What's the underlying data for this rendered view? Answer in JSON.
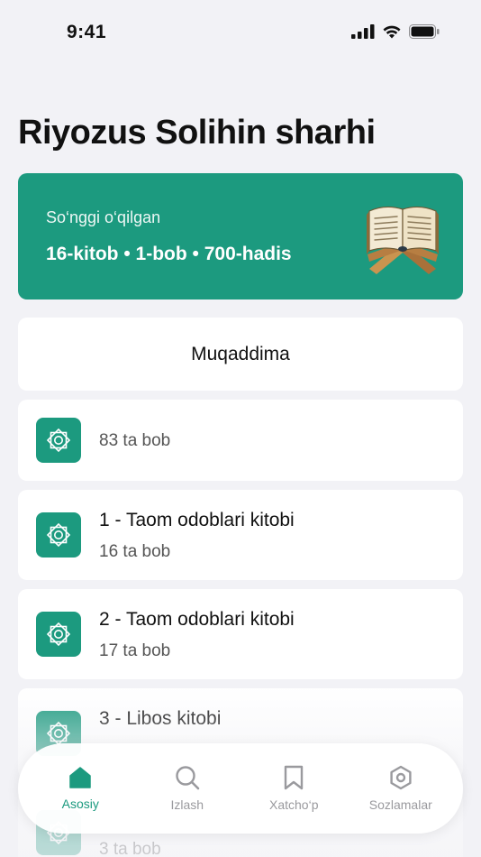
{
  "status_bar": {
    "time": "9:41"
  },
  "header": {
    "title": "Riyozus Solihin sharhi"
  },
  "last_read": {
    "label": "So‘nggi o‘qilgan",
    "value": "16-kitob • 1-bob • 700-hadis",
    "icon": "quran-stand-icon"
  },
  "intro": {
    "label": "Muqaddima"
  },
  "books": [
    {
      "title": "",
      "subtitle": "83 ta bob"
    },
    {
      "title": "1 - Taom odoblari kitobi",
      "subtitle": "16 ta bob"
    },
    {
      "title": "2 - Taom odoblari kitobi",
      "subtitle": "17 ta bob"
    },
    {
      "title": "3 - Libos kitobi",
      "subtitle": ""
    },
    {
      "title": "",
      "subtitle": "3 ta bob"
    }
  ],
  "tabs": [
    {
      "label": "Asosiy",
      "icon": "home-icon",
      "active": true
    },
    {
      "label": "Izlash",
      "icon": "search-icon",
      "active": false
    },
    {
      "label": "Xatcho‘p",
      "icon": "bookmark-icon",
      "active": false
    },
    {
      "label": "Sozlamalar",
      "icon": "settings-icon",
      "active": false
    }
  ],
  "colors": {
    "accent": "#1c9a7f",
    "background": "#f2f2f6",
    "inactive": "#9a9a9e"
  }
}
